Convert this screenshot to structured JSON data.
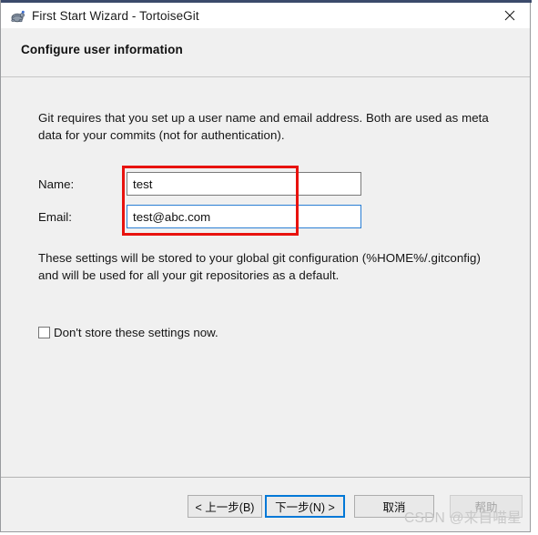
{
  "window": {
    "title": "First Start Wizard - TortoiseGit",
    "app_icon": "tortoise-icon",
    "close_icon": "close-icon"
  },
  "header": {
    "title": "Configure user information"
  },
  "content": {
    "intro_text": "Git requires that you set up a user name and email address. Both are used as meta data for your commits (not for authentication).",
    "storage_text": "These settings will be stored to your global git configuration (%HOME%/.gitconfig) and will be used for all your git repositories as a default.",
    "fields": [
      {
        "label": "Name:",
        "value": "test",
        "placeholder": "",
        "focused": false
      },
      {
        "label": "Email:",
        "value": "test@abc.com",
        "placeholder": "",
        "focused": true
      }
    ],
    "checkbox": {
      "label": "Don't store these settings now.",
      "checked": false
    }
  },
  "annotation": {
    "color": "#e8120e",
    "shape": "rectangle"
  },
  "buttons": {
    "back": "< 上一步(B)",
    "next": "下一步(N) >",
    "cancel": "取消",
    "help": "帮助"
  },
  "watermark": {
    "text": "CSDN @来自喵星"
  },
  "colors": {
    "accent": "#0078d7",
    "annotation": "#e8120e",
    "dialog_background": "#f0f0f0",
    "titlebar_background": "#ffffff"
  }
}
